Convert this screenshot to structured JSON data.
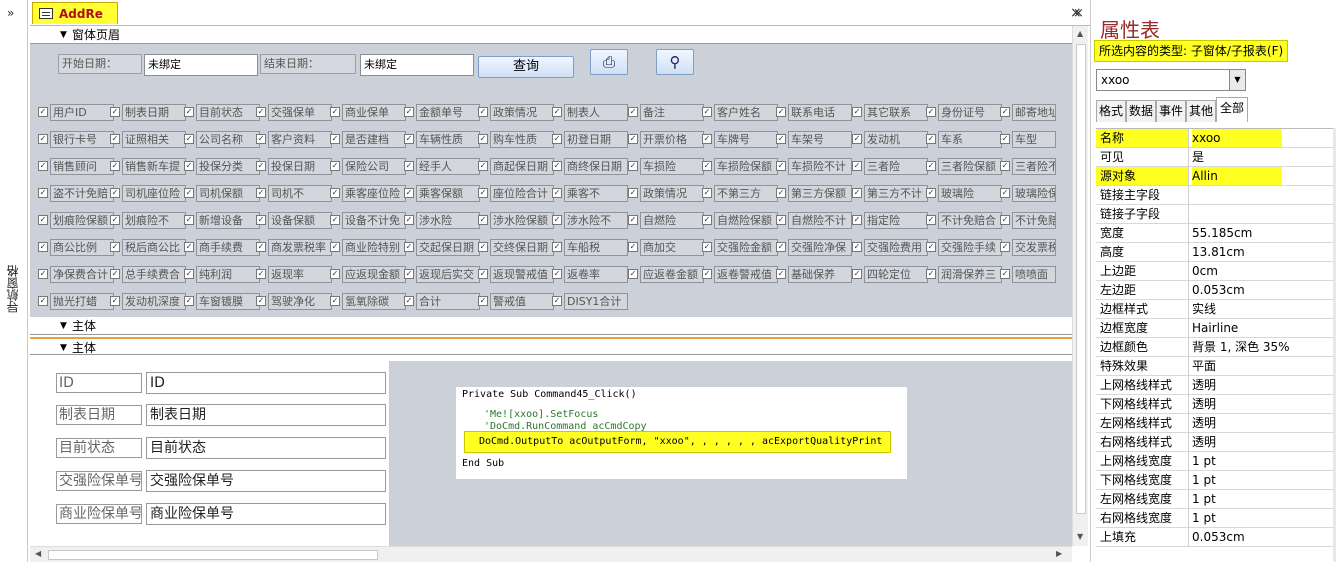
{
  "nav": {
    "chevron": "»",
    "label": "导航窗格"
  },
  "tab": {
    "title": "AddRe",
    "close": "×"
  },
  "sections": {
    "header": "窗体页眉",
    "detail": "主体",
    "detail2": "主体"
  },
  "search": {
    "start_label": "开始日期：",
    "start_value": "未绑定",
    "end_label": "结束日期：",
    "end_value": "未绑定",
    "query_button": "查询"
  },
  "fields": [
    [
      "用户ID",
      "制表日期",
      "目前状态",
      "交强保单",
      "商业保单",
      "金额单号",
      "政策情况",
      "制表人",
      "备注",
      "客户姓名",
      "联系电话",
      "其它联系",
      "身份证号",
      "邮寄地址"
    ],
    [
      "银行卡号",
      "证照相关",
      "公司名称",
      "客户资料",
      "是否建档",
      "车辆性质",
      "购车性质",
      "初登日期",
      "开票价格",
      "车牌号",
      "车架号",
      "发动机",
      "车系",
      "车型"
    ],
    [
      "销售顾问",
      "销售新车提",
      "投保分类",
      "投保日期",
      "保险公司",
      "经手人",
      "商起保日期",
      "商终保日期",
      "车损险",
      "车损险保额",
      "车损险不计",
      "三者险",
      "三者险保额",
      "三者险不计"
    ],
    [
      "盗不计免赔",
      "司机座位险",
      "司机保额",
      "司机不",
      "乘客座位险",
      "乘客保额",
      "座位险合计",
      "乘客不",
      "政策情况",
      "不第三方",
      "第三方保额",
      "第三方不计",
      "玻璃险",
      "玻璃险保额"
    ],
    [
      "划痕险保额",
      "划痕险不",
      "新增设备",
      "设备保额",
      "设备不计免",
      "涉水险",
      "涉水险保额",
      "涉水险不",
      "自燃险",
      "自燃险保额",
      "自燃险不计",
      "指定险",
      "不计免赔合",
      "不计免赔合"
    ],
    [
      "商公比例",
      "税后商公比",
      "商手续费",
      "商发票税率",
      "商业险特别",
      "交起保日期",
      "交终保日期",
      "车船税",
      "商加交",
      "交强险金额",
      "交强险净保",
      "交强险费用",
      "交强险手续",
      "交发票税点"
    ],
    [
      "净保费合计",
      "总手续费合",
      "纯利润",
      "返现率",
      "应返现金额",
      "返现后实交",
      "返现警戒值",
      "返卷率",
      "应返卷金额",
      "返卷警戒值",
      "基础保养",
      "四轮定位",
      "润滑保养三",
      "喷喷面"
    ],
    [
      "抛光打蜡",
      "发动机深度",
      "车窗镀膜",
      "驾驶净化",
      "氢氧除碳",
      "合计",
      "警戒值",
      "DISY1合计"
    ]
  ],
  "form_fields": [
    {
      "label": "ID",
      "value": "ID"
    },
    {
      "label": "制表日期",
      "value": "制表日期"
    },
    {
      "label": "目前状态",
      "value": "目前状态"
    },
    {
      "label": "交强险保单号",
      "value": "交强险保单号"
    },
    {
      "label": "商业险保单号",
      "value": "商业险保单号"
    }
  ],
  "code": {
    "line1": "Private Sub Command45_Click()",
    "line2": "'Me![xxoo].SetFocus",
    "line3": "'DoCmd.RunCommand acCmdCopy",
    "line4": "DoCmd.OutputTo acOutputForm, \"xxoo\", , , , , , acExportQualityPrint",
    "line5": "End Sub"
  },
  "property_sheet": {
    "title": "属性表",
    "selection_type": "所选内容的类型: 子窗体/子报表(F)",
    "object": "xxoo",
    "tabs": [
      "格式",
      "数据",
      "事件",
      "其他",
      "全部"
    ],
    "active_tab": "全部",
    "rows": [
      {
        "k": "名称",
        "v": "xxoo",
        "hl": true
      },
      {
        "k": "可见",
        "v": "是",
        "hl": false
      },
      {
        "k": "源对象",
        "v": "Allin",
        "hl": true
      },
      {
        "k": "链接主字段",
        "v": "",
        "hl": false
      },
      {
        "k": "链接子字段",
        "v": "",
        "hl": false
      },
      {
        "k": "宽度",
        "v": "55.185cm",
        "hl": false
      },
      {
        "k": "高度",
        "v": "13.81cm",
        "hl": false
      },
      {
        "k": "上边距",
        "v": "0cm",
        "hl": false
      },
      {
        "k": "左边距",
        "v": "0.053cm",
        "hl": false
      },
      {
        "k": "边框样式",
        "v": "实线",
        "hl": false
      },
      {
        "k": "边框宽度",
        "v": "Hairline",
        "hl": false
      },
      {
        "k": "边框颜色",
        "v": "背景 1, 深色 35%",
        "hl": false
      },
      {
        "k": "特殊效果",
        "v": "平面",
        "hl": false
      },
      {
        "k": "上网格线样式",
        "v": "透明",
        "hl": false
      },
      {
        "k": "下网格线样式",
        "v": "透明",
        "hl": false
      },
      {
        "k": "左网格线样式",
        "v": "透明",
        "hl": false
      },
      {
        "k": "右网格线样式",
        "v": "透明",
        "hl": false
      },
      {
        "k": "上网格线宽度",
        "v": "1 pt",
        "hl": false
      },
      {
        "k": "下网格线宽度",
        "v": "1 pt",
        "hl": false
      },
      {
        "k": "左网格线宽度",
        "v": "1 pt",
        "hl": false
      },
      {
        "k": "右网格线宽度",
        "v": "1 pt",
        "hl": false
      },
      {
        "k": "上填充",
        "v": "0.053cm",
        "hl": false
      }
    ]
  },
  "colors": {
    "highlight": "#ffff22",
    "section_grey": "#ccd1d9",
    "title_red": "#9a2a2a"
  }
}
